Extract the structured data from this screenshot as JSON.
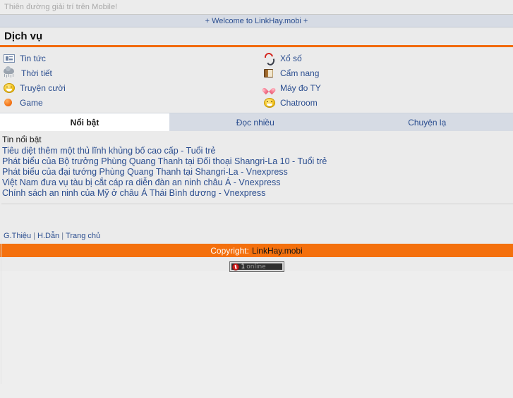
{
  "topbar": {
    "tagline": "Thiên đường giải trí trên Mobile!"
  },
  "welcome": {
    "text": "+ Welcome to LinkHay.mobi +"
  },
  "services": {
    "heading": "Dịch vụ",
    "left_items": [
      {
        "label": "Tin tức",
        "icon": "news-icon"
      },
      {
        "label": "Thời tiết",
        "icon": "weather-rain-cloud-icon"
      },
      {
        "label": "Truyện cười",
        "icon": "smiley-face-icon"
      },
      {
        "label": "Game",
        "icon": "orange-ball-icon"
      }
    ],
    "right_items": [
      {
        "label": "Xổ số",
        "icon": "red-swirl-icon"
      },
      {
        "label": "Cẩm nang",
        "icon": "book-icon"
      },
      {
        "label": "Máy đo TY",
        "icon": "heart-icon"
      },
      {
        "label": "Chatroom",
        "icon": "smiley-face-icon"
      }
    ]
  },
  "tabs": [
    {
      "label": "Nổi bật",
      "active": true
    },
    {
      "label": "Đọc nhiều",
      "active": false
    },
    {
      "label": "Chuyện lạ",
      "active": false
    }
  ],
  "news": {
    "section_title": "Tin nổi bật",
    "items": [
      "Tiêu diệt thêm một thủ lĩnh khủng bố cao cấp - Tuổi trẻ",
      "Phát biểu của Bộ trưởng Phùng Quang Thanh tại Đối thoại Shangri-La 10 - Tuổi trẻ",
      "Phát biểu của đại tướng Phùng Quang Thanh tại Shangri-La - Vnexpress",
      "Việt Nam đưa vụ tàu bị cắt cáp ra diễn đàn an ninh châu Á - Vnexpress",
      "Chính sách an ninh của Mỹ ở châu Á Thái Bình dương - Vnexpress"
    ]
  },
  "footer": {
    "links": [
      {
        "label": "G.Thiệu"
      },
      {
        "label": "H.Dẫn"
      },
      {
        "label": "Trang chủ"
      }
    ],
    "separator": "|",
    "copyright_label": "Copyright:",
    "copyright_site": "LinkHay.mobi"
  },
  "counter": {
    "count": "1",
    "word": "online"
  },
  "colors": {
    "accent_orange": "#f4700d",
    "link_blue": "#2a4d8f",
    "tab_bg": "#d6dbe4",
    "page_bg": "#eeeeee",
    "content_bg": "#ebebeb"
  }
}
